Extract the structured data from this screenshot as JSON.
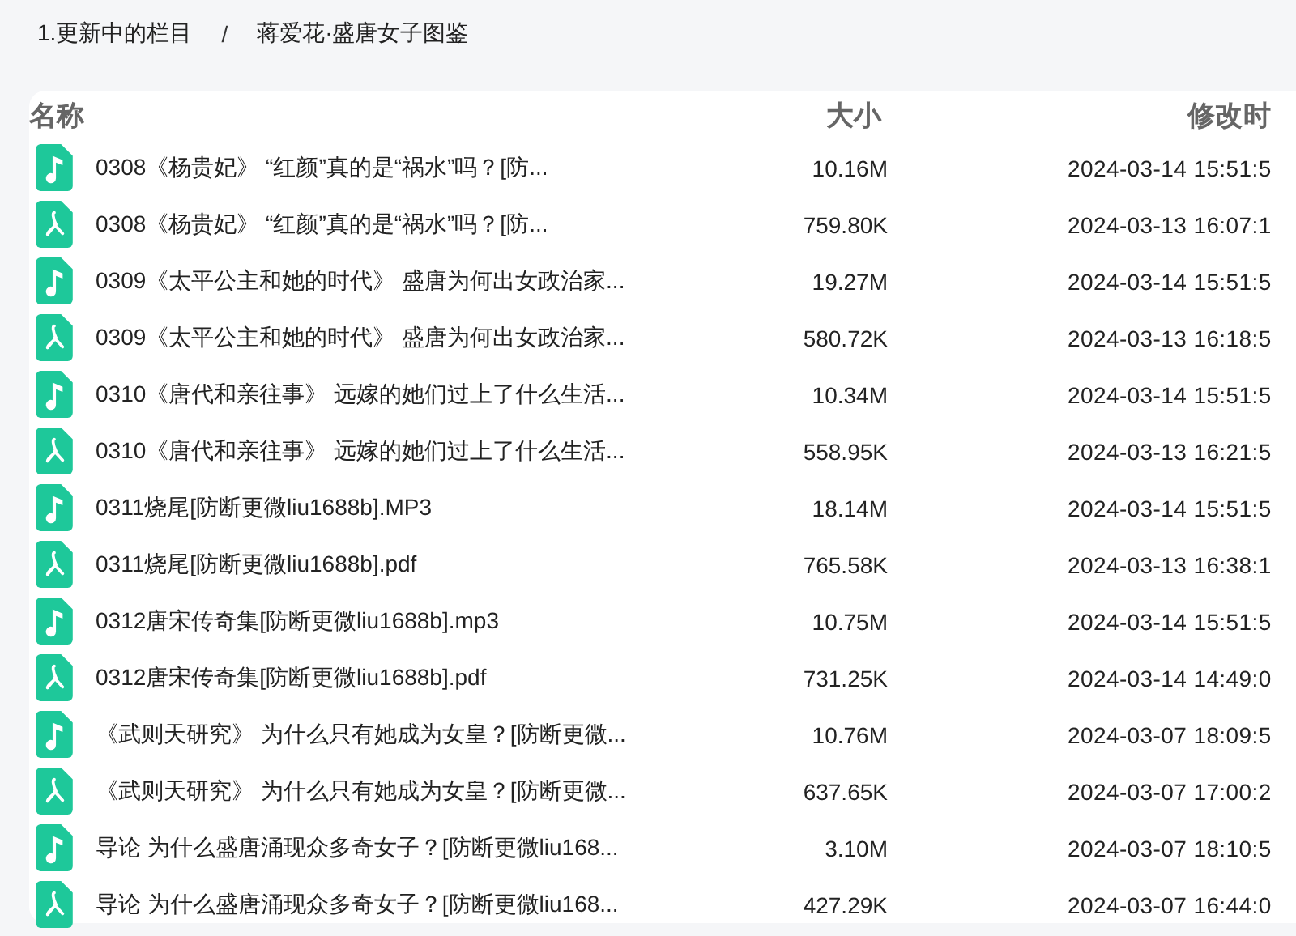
{
  "breadcrumb": [
    {
      "label": "1.更新中的栏目"
    },
    {
      "label": "蒋爱花·盛唐女子图鉴"
    }
  ],
  "breadcrumb_separator": "/",
  "table": {
    "columns": [
      "名称",
      "大小",
      "修改时"
    ],
    "rows": [
      {
        "kind": "audio",
        "name": "0308《杨贵妃》 “红颜”真的是“祸水”吗？[防...",
        "size": "10.16M",
        "modified": "2024-03-14 15:51:5"
      },
      {
        "kind": "pdf",
        "name": "0308《杨贵妃》 “红颜”真的是“祸水”吗？[防...",
        "size": "759.80K",
        "modified": "2024-03-13 16:07:1"
      },
      {
        "kind": "audio",
        "name": "0309《太平公主和她的时代》 盛唐为何出女政治家...",
        "size": "19.27M",
        "modified": "2024-03-14 15:51:5"
      },
      {
        "kind": "pdf",
        "name": "0309《太平公主和她的时代》 盛唐为何出女政治家...",
        "size": "580.72K",
        "modified": "2024-03-13 16:18:5"
      },
      {
        "kind": "audio",
        "name": "0310《唐代和亲往事》 远嫁的她们过上了什么生活...",
        "size": "10.34M",
        "modified": "2024-03-14 15:51:5"
      },
      {
        "kind": "pdf",
        "name": "0310《唐代和亲往事》 远嫁的她们过上了什么生活...",
        "size": "558.95K",
        "modified": "2024-03-13 16:21:5"
      },
      {
        "kind": "audio",
        "name": "0311烧尾[防断更微liu1688b].MP3",
        "size": "18.14M",
        "modified": "2024-03-14 15:51:5"
      },
      {
        "kind": "pdf",
        "name": "0311烧尾[防断更微liu1688b].pdf",
        "size": "765.58K",
        "modified": "2024-03-13 16:38:1"
      },
      {
        "kind": "audio",
        "name": "0312唐宋传奇集[防断更微liu1688b].mp3",
        "size": "10.75M",
        "modified": "2024-03-14 15:51:5"
      },
      {
        "kind": "pdf",
        "name": "0312唐宋传奇集[防断更微liu1688b].pdf",
        "size": "731.25K",
        "modified": "2024-03-14 14:49:0"
      },
      {
        "kind": "audio",
        "name": "《武则天研究》 为什么只有她成为女皇？[防断更微...",
        "size": "10.76M",
        "modified": "2024-03-07 18:09:5"
      },
      {
        "kind": "pdf",
        "name": "《武则天研究》 为什么只有她成为女皇？[防断更微...",
        "size": "637.65K",
        "modified": "2024-03-07 17:00:2"
      },
      {
        "kind": "audio",
        "name": "导论 为什么盛唐涌现众多奇女子？[防断更微liu168...",
        "size": "3.10M",
        "modified": "2024-03-07 18:10:5"
      },
      {
        "kind": "pdf",
        "name": "导论 为什么盛唐涌现众多奇女子？[防断更微liu168...",
        "size": "427.29K",
        "modified": "2024-03-07 16:44:0"
      }
    ]
  }
}
